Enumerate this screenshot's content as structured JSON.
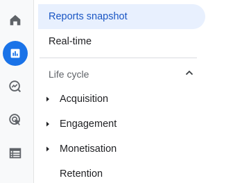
{
  "rail": {
    "items": [
      {
        "icon": "home-icon"
      },
      {
        "icon": "reports-icon",
        "active": true
      },
      {
        "icon": "explore-icon"
      },
      {
        "icon": "advertising-icon"
      },
      {
        "icon": "configure-icon"
      }
    ],
    "active_color": "#1a73e8"
  },
  "nav": {
    "reports_snapshot": "Reports snapshot",
    "realtime": "Real-time",
    "section_title": "Life cycle",
    "sub_items": [
      {
        "label": "Acquisition"
      },
      {
        "label": "Engagement"
      },
      {
        "label": "Monetisation"
      },
      {
        "label": "Retention"
      }
    ]
  }
}
